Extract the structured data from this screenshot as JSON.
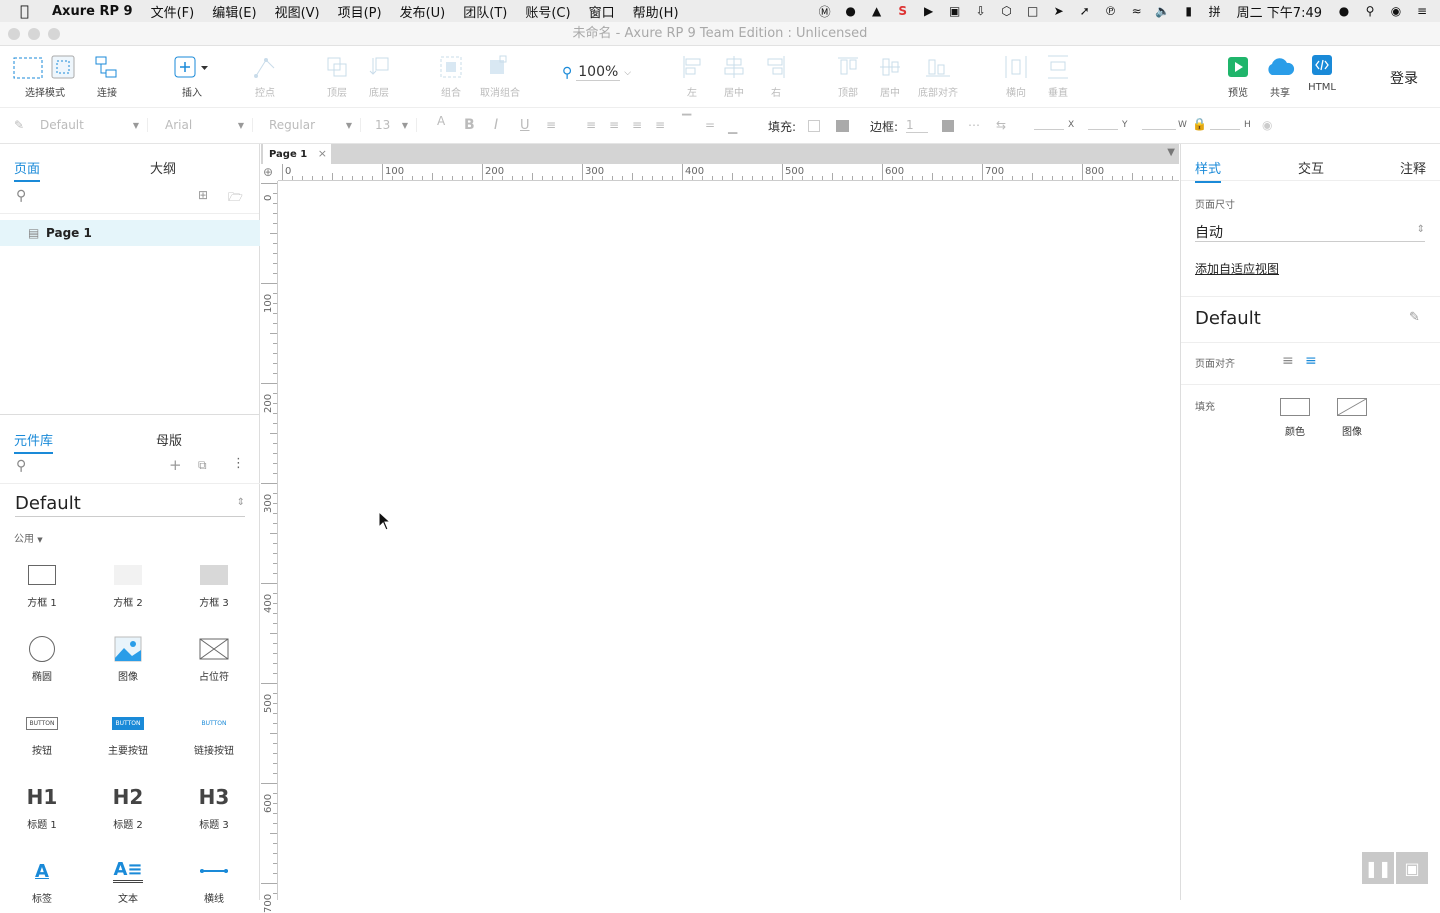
{
  "menubar": {
    "app_name": "Axure RP 9",
    "items": [
      "文件(F)",
      "编辑(E)",
      "视图(V)",
      "项目(P)",
      "发布(U)",
      "团队(T)",
      "账号(C)",
      "窗口",
      "帮助(H)"
    ],
    "clock": "周二 下午7:49"
  },
  "window_title": "未命名 - Axure RP 9 Team Edition : Unlicensed",
  "toolbar": {
    "select_mode": "选择模式",
    "connect": "连接",
    "insert": "插入",
    "points": "控点",
    "top_layer": "顶层",
    "bottom_layer": "底层",
    "group": "组合",
    "ungroup": "取消组合",
    "zoom": "100%",
    "align_left": "左",
    "align_center": "居中",
    "align_right": "右",
    "align_top": "顶部",
    "align_middle": "居中",
    "align_bottom": "底部对齐",
    "distribute_h": "横向",
    "distribute_v": "垂直",
    "preview": "预览",
    "share": "共享",
    "html": "HTML",
    "login": "登录"
  },
  "formatbar": {
    "style": "Default",
    "font": "Arial",
    "weight": "Regular",
    "size": "13",
    "fill_label": "填充:",
    "border_label": "边框:",
    "border_value": "1",
    "x": "X",
    "y": "Y",
    "w": "W",
    "h": "H"
  },
  "left_panel": {
    "tab_pages": "页面",
    "tab_outline": "大纲",
    "page_item": "Page 1",
    "tab_library": "元件库",
    "tab_masters": "母版",
    "library_name": "Default",
    "category": "公用",
    "widgets": [
      "方框 1",
      "方框 2",
      "方框 3",
      "椭圆",
      "图像",
      "占位符",
      "按钮",
      "主要按钮",
      "链接按钮",
      "标题 1",
      "标题 2",
      "标题 3",
      "标签",
      "文本",
      "横线"
    ],
    "button_text": "BUTTON",
    "h1": "H1",
    "h2": "H2",
    "h3": "H3"
  },
  "canvas": {
    "tab_label": "Page 1",
    "h_ticks": [
      "0",
      "100",
      "200",
      "300",
      "400",
      "500",
      "600",
      "700",
      "800"
    ],
    "v_ticks": [
      "0",
      "100",
      "200",
      "300",
      "400",
      "500",
      "600",
      "700"
    ]
  },
  "right_panel": {
    "tab_style": "样式",
    "tab_interact": "交互",
    "tab_notes": "注释",
    "page_size_label": "页面尺寸",
    "page_size_value": "自动",
    "add_adaptive": "添加自适应视图",
    "style_name": "Default",
    "page_align_label": "页面对齐",
    "fill_label": "填充",
    "fill_color": "颜色",
    "fill_image": "图像"
  },
  "colors": {
    "accent": "#1a8ad8",
    "selected_page_bg": "#e5f5fa"
  }
}
